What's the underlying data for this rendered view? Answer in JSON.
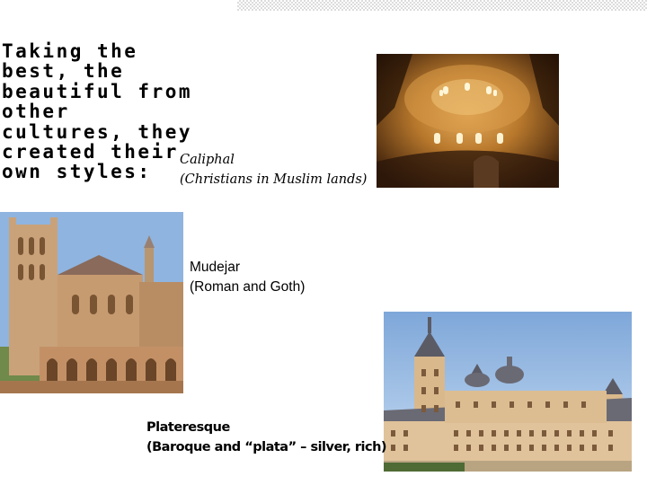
{
  "title_lines": [
    "Taking the",
    "best, the",
    "beautiful from",
    "other",
    "cultures, they",
    "created their",
    "own styles:"
  ],
  "captions": {
    "caliph": [
      "Caliphal",
      "(Christians in Muslim lands)"
    ],
    "mudejar": [
      "Mudejar",
      "(Roman and Goth)"
    ],
    "plateresque": [
      "Plateresque",
      "(Baroque and “plata” – silver, rich)"
    ]
  },
  "colors": {
    "header_pattern": "#dcdcdc",
    "alhambra_gold": "#c4882f",
    "burgos_stone": "#c9a27a",
    "escorial_stone": "#e0c39a",
    "sky": "#8fb4df"
  }
}
